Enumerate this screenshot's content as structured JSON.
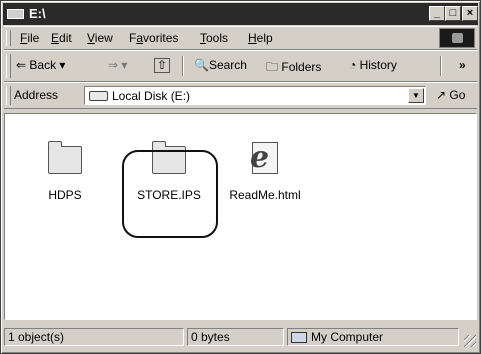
{
  "window": {
    "title": "E:\\"
  },
  "menu": [
    {
      "pre": "",
      "key": "F",
      "post": "ile"
    },
    {
      "pre": "",
      "key": "E",
      "post": "dit"
    },
    {
      "pre": "",
      "key": "V",
      "post": "iew"
    },
    {
      "pre": "F",
      "key": "a",
      "post": "vorites"
    },
    {
      "pre": "",
      "key": "T",
      "post": "ools"
    },
    {
      "pre": "",
      "key": "H",
      "post": "elp"
    }
  ],
  "toolbar": {
    "back": "⇐ Back",
    "back_arrow": "▾",
    "forward": "⇒",
    "forward_arrow": "▾",
    "up": "⇧",
    "search": "Search",
    "folders": "Folders",
    "history": "History",
    "more": "»"
  },
  "address": {
    "label": "Address",
    "value": "Local Disk (E:)",
    "go": "Go"
  },
  "files": [
    {
      "name": "HDPS",
      "icon": "folder-icon"
    },
    {
      "name": "STORE.IPS",
      "icon": "folder-icon"
    },
    {
      "name": "ReadMe.html",
      "icon": "html-file-icon"
    }
  ],
  "status": {
    "objects": "1 object(s)",
    "size": "0 bytes",
    "zone": "My Computer"
  }
}
